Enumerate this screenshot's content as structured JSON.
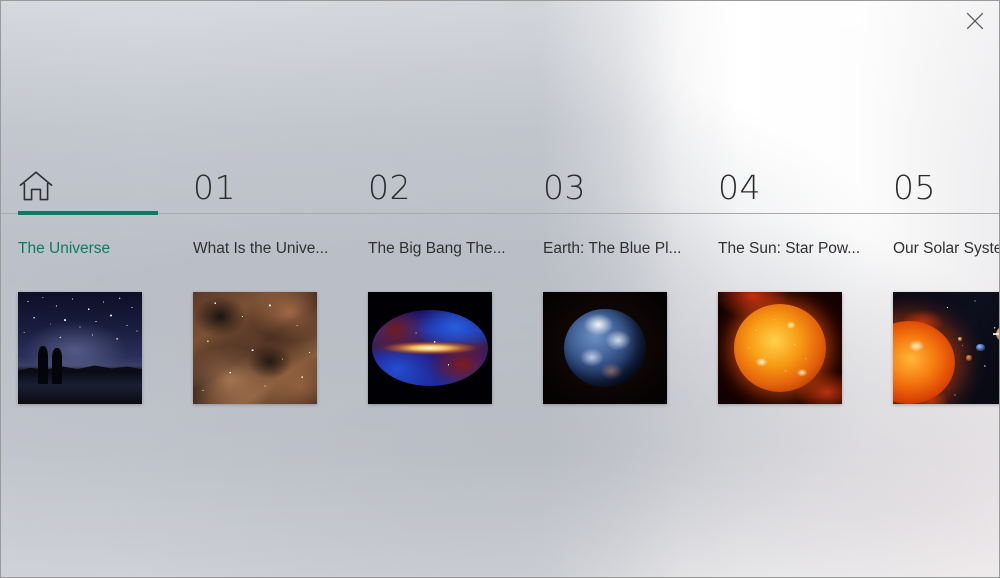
{
  "window": {
    "title": "The Universe",
    "close_icon": "close-icon",
    "close_label": "Close"
  },
  "accent": {
    "teal": "#0d7a64",
    "text_dark": "#2b2b2b",
    "rule": "#a9a9ac"
  },
  "nav": {
    "selected_index": 0,
    "tabs": [
      {
        "num": "",
        "icon": "home-icon",
        "label": "The Universe",
        "thumb": "starry-night-lake-silhouettes",
        "selected": true
      },
      {
        "num": "01",
        "icon": "",
        "label": "What Is the Unive...",
        "thumb": "orange-brown-nebula-dust",
        "selected": false
      },
      {
        "num": "02",
        "icon": "",
        "label": "The Big Bang The...",
        "thumb": "all-sky-galactic-plane-map",
        "selected": false
      },
      {
        "num": "03",
        "icon": "",
        "label": "Earth: The Blue Pl...",
        "thumb": "earth-blue-marble",
        "selected": false
      },
      {
        "num": "04",
        "icon": "",
        "label": "The Sun: Star Pow...",
        "thumb": "sun-with-solar-flares",
        "selected": false
      },
      {
        "num": "05",
        "icon": "",
        "label": "Our Solar Syste",
        "thumb": "solar-system-sun-and-planets",
        "selected": false
      }
    ]
  }
}
